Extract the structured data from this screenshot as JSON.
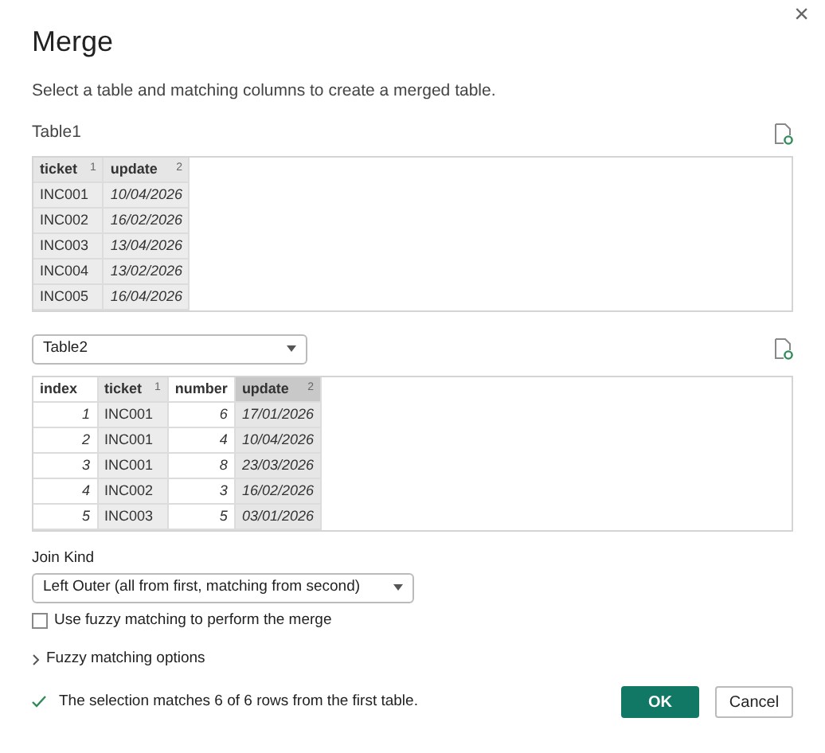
{
  "window": {
    "title": "Merge",
    "close": "×"
  },
  "description": "Select a table and matching columns to create a merged table.",
  "table1": {
    "label": "Table1",
    "columns": [
      {
        "name": "ticket",
        "kind": "text",
        "selected": true,
        "focused": false,
        "order": "1"
      },
      {
        "name": "update",
        "kind": "date",
        "selected": true,
        "focused": false,
        "order": "2"
      }
    ],
    "rows": [
      [
        "INC001",
        "10/04/2026"
      ],
      [
        "INC002",
        "16/02/2026"
      ],
      [
        "INC003",
        "13/04/2026"
      ],
      [
        "INC004",
        "13/02/2026"
      ],
      [
        "INC005",
        "16/04/2026"
      ]
    ]
  },
  "table2": {
    "value": "Table2",
    "columns": [
      {
        "name": "index",
        "kind": "number",
        "selected": false,
        "focused": false
      },
      {
        "name": "ticket",
        "kind": "text",
        "selected": true,
        "focused": false,
        "order": "1"
      },
      {
        "name": "number",
        "kind": "number",
        "selected": false,
        "focused": false
      },
      {
        "name": "update",
        "kind": "date",
        "selected": true,
        "focused": true,
        "order": "2"
      }
    ],
    "rows": [
      [
        "1",
        "INC001",
        "6",
        "17/01/2026"
      ],
      [
        "2",
        "INC001",
        "4",
        "10/04/2026"
      ],
      [
        "3",
        "INC001",
        "8",
        "23/03/2026"
      ],
      [
        "4",
        "INC002",
        "3",
        "16/02/2026"
      ],
      [
        "5",
        "INC003",
        "5",
        "03/01/2026"
      ]
    ]
  },
  "join_kind": {
    "label": "Join Kind",
    "value": "Left Outer (all from first, matching from second)"
  },
  "fuzzy": {
    "label": "Use fuzzy matching to perform the merge",
    "checked": false
  },
  "fuzzy_options": {
    "label": "Fuzzy matching options",
    "expanded": false
  },
  "status": "The selection matches 6 of 6 rows from the first table.",
  "buttons": [
    {
      "label": "OK",
      "kind": "primary"
    },
    {
      "label": "Cancel",
      "kind": "secondary"
    }
  ]
}
